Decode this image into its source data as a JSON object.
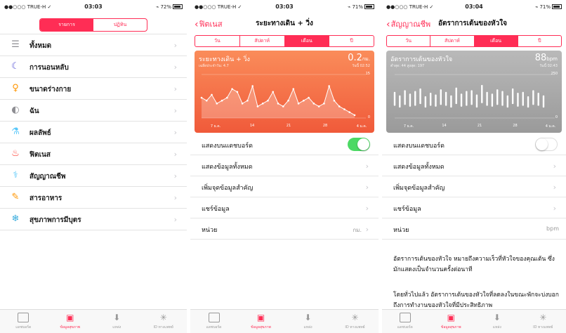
{
  "status": {
    "carrier": "●●○○○ TRUE-H ✓",
    "s1_time": "03:03",
    "s1_battery": "72%",
    "s2_time": "03:03",
    "s2_battery": "71%",
    "s3_time": "03:04",
    "s3_battery": "71%"
  },
  "screen1": {
    "segment": [
      "รายการ",
      "ปฏิทิน"
    ],
    "categories": [
      {
        "label": "ทั้งหมด",
        "icon": "list-icon",
        "color": "#8e8e93"
      },
      {
        "label": "การนอนหลับ",
        "icon": "moon-icon",
        "color": "#5856d6"
      },
      {
        "label": "ขนาดร่างกาย",
        "icon": "body-icon",
        "color": "#ff9500"
      },
      {
        "label": "ฉัน",
        "icon": "person-icon",
        "color": "#8e8e93"
      },
      {
        "label": "ผลลัพธ์",
        "icon": "flask-icon",
        "color": "#5ac8fa"
      },
      {
        "label": "ฟิตเนส",
        "icon": "flame-icon",
        "color": "#ff3b30"
      },
      {
        "label": "สัญญาณชีพ",
        "icon": "stethoscope-icon",
        "color": "#5ac8fa"
      },
      {
        "label": "สารอาหาร",
        "icon": "carrot-icon",
        "color": "#ff9500"
      },
      {
        "label": "สุขภาพการมีบุตร",
        "icon": "snowflake-icon",
        "color": "#34aadc"
      }
    ]
  },
  "screen2": {
    "back": "ฟิตเนส",
    "title": "ระยะทางเดิน + วิ่ง",
    "segment": [
      "วัน",
      "สัปดาห์",
      "เดือน",
      "ปี"
    ],
    "card_title": "ระยะทางเดิน + วิ่ง",
    "card_sub": "เฉลี่ยประจำวัน: 4.7",
    "card_value": "0.2",
    "card_unit": "กม.",
    "card_date": "วันนี้ 02:52",
    "rows": [
      {
        "label": "แสดงบนแดชบอร์ด"
      },
      {
        "label": "แสดงข้อมูลทั้งหมด"
      },
      {
        "label": "เพิ่มจุดข้อมูลสำคัญ"
      },
      {
        "label": "แชร์ข้อมูล"
      },
      {
        "label": "หน่วย",
        "value": "กม."
      }
    ]
  },
  "screen3": {
    "back": "สัญญาณชีพ",
    "title": "อัตราการเต้นของหัวใจ",
    "segment": [
      "วัน",
      "สัปดาห์",
      "เดือน",
      "ปี"
    ],
    "card_title": "อัตราการเต้นของหัวใจ",
    "card_sub": "ต่ำสุด: 44  สูงสุด: 197",
    "card_value": "88",
    "card_unit": "bpm",
    "card_date": "วันนี้ 02:43",
    "rows": [
      {
        "label": "แสดงบนแดชบอร์ด"
      },
      {
        "label": "แสดงข้อมูลทั้งหมด"
      },
      {
        "label": "เพิ่มจุดข้อมูลสำคัญ"
      },
      {
        "label": "แชร์ข้อมูล"
      },
      {
        "label": "หน่วย",
        "value": "bpm"
      }
    ],
    "desc1": "อัตราการเต้นของหัวใจ หมายถึงความเร็วที่หัวใจของคุณเต้น ซึ่งมักแสดงเป็นจำนวนครั้งต่อนาที",
    "desc2": "โดยทั่วไปแล้ว อัตราการเต้นของหัวใจที่ลดลงในขณะพักจะบ่งบอกถึงการทำงานของหัวใจที่มีประสิทธิภาพ"
  },
  "tabs": [
    {
      "label": "แดชบอร์ด",
      "icon": "dashboard-icon"
    },
    {
      "label": "ข้อมูลสุขภาพ",
      "icon": "health-data-icon"
    },
    {
      "label": "แหล่ง",
      "icon": "sources-icon"
    },
    {
      "label": "ID ทางแพทย์",
      "icon": "medical-id-icon"
    }
  ],
  "chart_data": [
    {
      "type": "line",
      "title": "ระยะทางเดิน + วิ่ง",
      "x_ticks": [
        "7 ธ.ค.",
        "14",
        "21",
        "28",
        "4 ม.ค."
      ],
      "ylim": [
        0,
        15
      ],
      "values": [
        7,
        6,
        8,
        5,
        6,
        7,
        10,
        9,
        5,
        6,
        11,
        4,
        5,
        6,
        9,
        5,
        4,
        6,
        10,
        5,
        6,
        7,
        5,
        4,
        5,
        11,
        6,
        4,
        3,
        2,
        1
      ],
      "accent": "#f05a3a"
    },
    {
      "type": "bar",
      "title": "อัตราการเต้นของหัวใจ",
      "x_ticks": [
        "7 ธ.ค.",
        "14",
        "21",
        "28",
        "4 ม.ค."
      ],
      "ylim": [
        0,
        250
      ],
      "ranges": [
        [
          70,
          150
        ],
        [
          60,
          130
        ],
        [
          75,
          160
        ],
        [
          65,
          140
        ],
        [
          70,
          155
        ],
        [
          80,
          170
        ],
        [
          60,
          125
        ],
        [
          70,
          145
        ],
        [
          65,
          135
        ],
        [
          75,
          165
        ],
        [
          70,
          150
        ],
        [
          60,
          130
        ],
        [
          80,
          175
        ],
        [
          65,
          140
        ],
        [
          70,
          155
        ],
        [
          75,
          160
        ],
        [
          60,
          135
        ],
        [
          85,
          190
        ],
        [
          70,
          150
        ],
        [
          65,
          140
        ],
        [
          75,
          165
        ],
        [
          70,
          155
        ],
        [
          60,
          130
        ],
        [
          80,
          170
        ],
        [
          65,
          145
        ],
        [
          70,
          150
        ],
        [
          60,
          125
        ],
        [
          75,
          160
        ],
        [
          70,
          145
        ],
        [
          60,
          130
        ]
      ],
      "accent": "#9a9a9a"
    }
  ]
}
